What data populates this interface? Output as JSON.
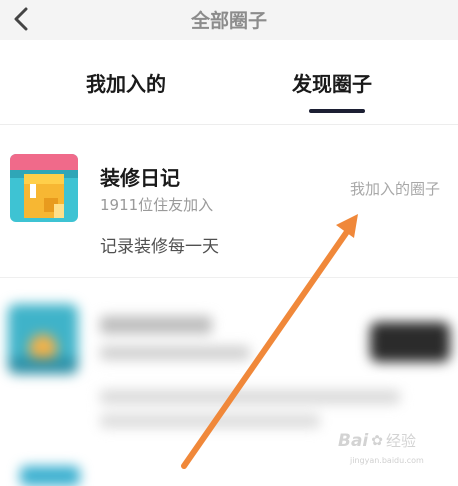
{
  "header": {
    "title": "全部圈子",
    "back_icon": "chevron-left-icon"
  },
  "tabs": [
    {
      "label": "我加入的",
      "active": false
    },
    {
      "label": "发现圈子",
      "active": true
    }
  ],
  "circles": [
    {
      "name": "装修日记",
      "member_count": "1911位住友加入",
      "description": "记录装修每一天",
      "status": "我加入的圈子",
      "icon": "paint-roller-icon"
    }
  ],
  "colors": {
    "active_tab_indicator": "#1c1f33",
    "arrow": "#f0883a",
    "thumb_bg": "#3ec3d3",
    "thumb_accent": "#f7b733"
  },
  "watermark": {
    "brand": "Bai",
    "paw_icon": "paw-icon",
    "cn": "经验",
    "url": "jingyan.baidu.com"
  }
}
